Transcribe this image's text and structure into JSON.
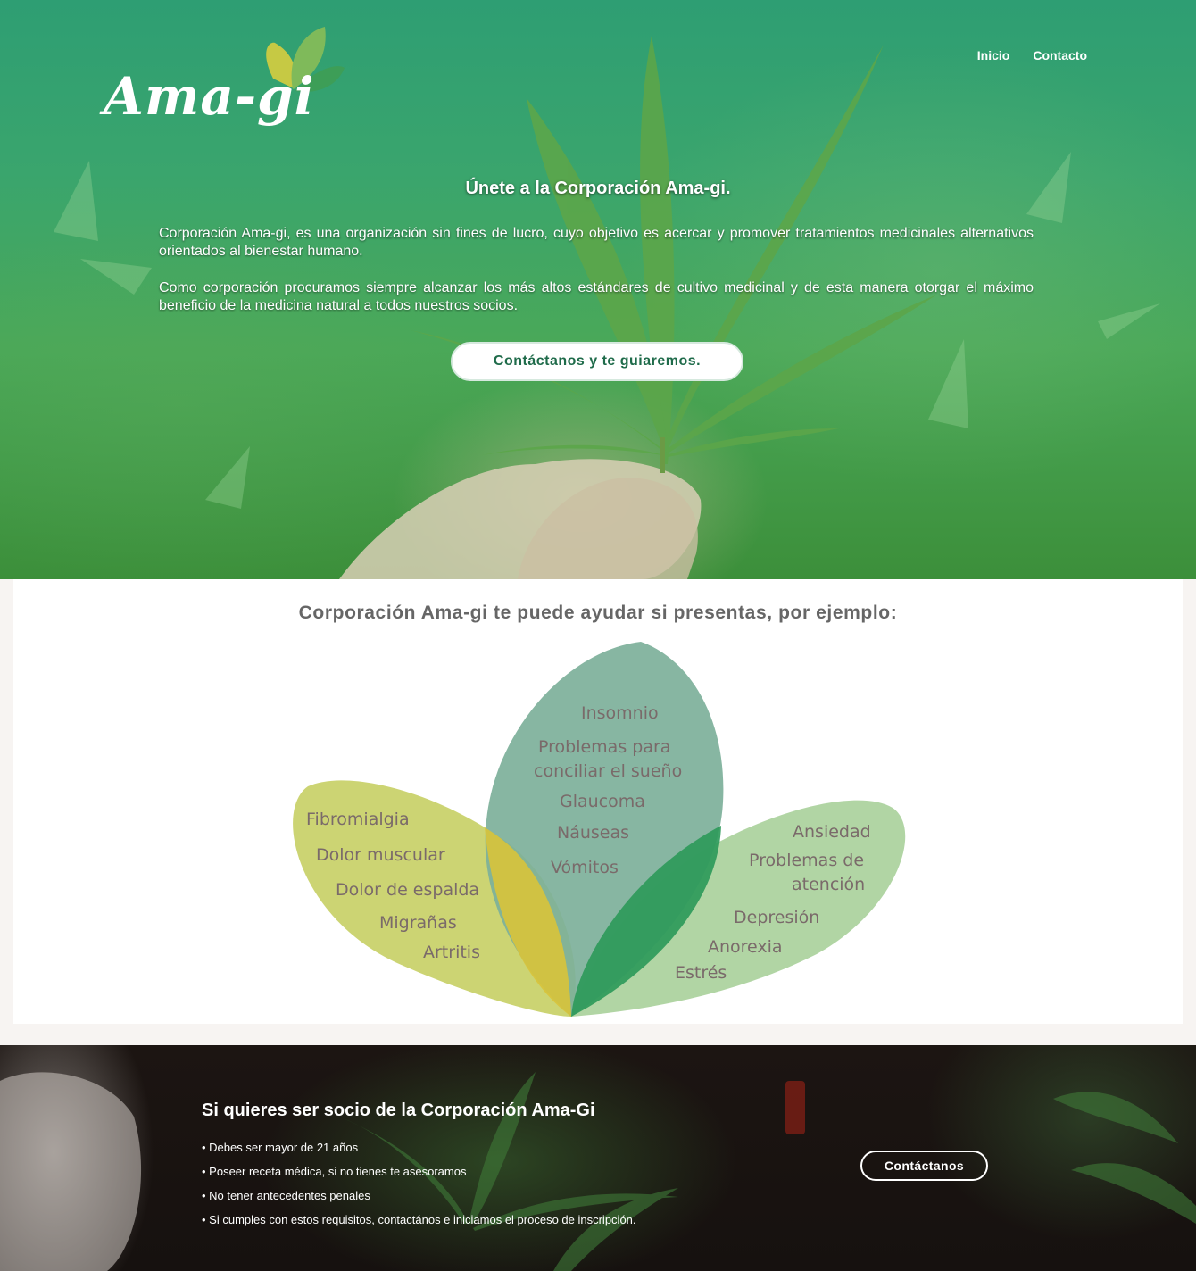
{
  "header": {
    "logo_text": "Ama-gi",
    "nav": [
      {
        "label": "Inicio"
      },
      {
        "label": "Contacto"
      }
    ]
  },
  "hero": {
    "title": "Únete a la Corporación Ama-gi.",
    "paragraph1": "Corporación Ama-gi, es una organización sin fines de lucro, cuyo objetivo es acercar y promover tratamientos medicinales alternativos orientados al bienestar humano.",
    "paragraph2": "Como corporación procuramos siempre alcanzar los más altos estándares de cultivo medicinal y de esta manera otorgar el máximo beneficio de la medicina natural a todos nuestros socios.",
    "cta_label": "Contáctanos y te guiaremos."
  },
  "conditions": {
    "title": "Corporación Ama-gi te puede ayudar si presentas, por ejemplo:",
    "left_leaf": [
      "Fibromialgia",
      "Dolor muscular",
      "Dolor de espalda",
      "Migrañas",
      "Artritis"
    ],
    "center_leaf": [
      "Insomnio",
      "Problemas para",
      "conciliar el sueño",
      "Glaucoma",
      "Náuseas",
      "Vómitos"
    ],
    "right_leaf": [
      "Ansiedad",
      "Problemas de",
      "atención",
      "Depresión",
      "Anorexia",
      "Estrés"
    ],
    "colors": {
      "left_leaf": "#c3cc5a",
      "center_leaf": "#7db09a",
      "right_leaf": "#a8d09a",
      "overlap_left": "#d8c33a",
      "overlap_right": "#2e9a5a",
      "text": "#7a6a6a"
    }
  },
  "membership": {
    "title": "Si quieres ser socio de la Corporación Ama-Gi",
    "requirements": [
      "• Debes ser mayor de 21 años",
      "• Poseer receta médica, si no tienes te asesoramos",
      "• No tener antecedentes penales",
      "• Si cumples con estos requisitos, contactános e iniciamos el proceso de inscripción."
    ],
    "cta_label": "Contáctanos"
  }
}
